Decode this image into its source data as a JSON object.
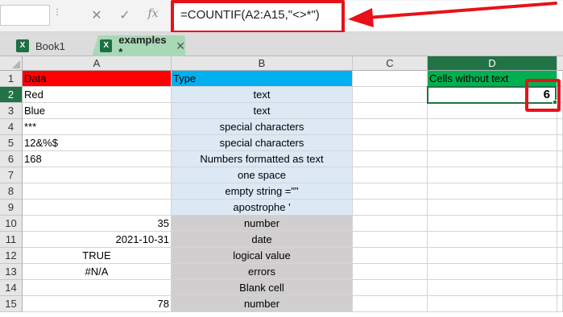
{
  "formula_bar": {
    "formula": "=COUNTIF(A2:A15,\"<>*\")",
    "fx_label": "fx",
    "cancel_icon": "close-icon",
    "enter_icon": "check-icon"
  },
  "tabs": [
    {
      "label": "Book1",
      "active": false
    },
    {
      "label": "examples *",
      "active": true
    }
  ],
  "columns": [
    "A",
    "B",
    "C",
    "D"
  ],
  "rows": [
    "1",
    "2",
    "3",
    "4",
    "5",
    "6",
    "7",
    "8",
    "9",
    "10",
    "11",
    "12",
    "13",
    "14",
    "15"
  ],
  "active_cell": "D2",
  "cells": {
    "A": [
      "Data",
      "Red",
      "Blue",
      "***",
      "12&%$",
      "168",
      "",
      "",
      "",
      "35",
      "2021-10-31",
      "TRUE",
      "#N/A",
      "",
      "78"
    ],
    "B": [
      "Type",
      "text",
      "text",
      "special characters",
      "special characters",
      "Numbers formatted as text",
      "one space",
      "empty string =\"\"",
      "apostrophe '",
      "number",
      "date",
      "logical value",
      "errors",
      "Blank cell",
      "number"
    ],
    "D": [
      "Cells without text",
      "6"
    ]
  },
  "colors": {
    "header_red": "#ff0000",
    "header_blue": "#00b0f0",
    "header_green": "#00b050",
    "text_types_fill": "#dce9f5",
    "non_text_fill": "#d0cece",
    "annotation_red": "#e8111a",
    "excel_green": "#217346"
  }
}
